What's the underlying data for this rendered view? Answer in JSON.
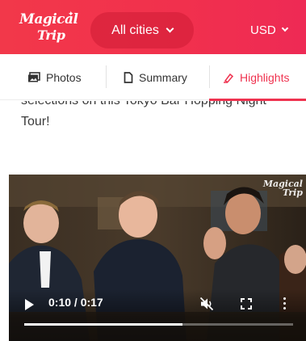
{
  "header": {
    "logo_line1": "Magical",
    "logo_line2": "Trip",
    "city_label": "All cities",
    "currency_label": "USD",
    "colors": {
      "brand_red": "#f1304d"
    }
  },
  "tabs": [
    {
      "label": "Photos",
      "icon": "photos-icon",
      "active": false
    },
    {
      "label": "Summary",
      "icon": "summary-icon",
      "active": false
    },
    {
      "label": "Highlights",
      "icon": "highlights-icon",
      "active": true
    }
  ],
  "description": {
    "line1": "selections on this Tokyo Bar Hopping Night",
    "line2": "Tour!"
  },
  "video": {
    "watermark_line1": "Magical",
    "watermark_line2": "Trip",
    "time_display": "0:10 / 0:17",
    "progress_fraction": 0.59,
    "muted": true
  }
}
